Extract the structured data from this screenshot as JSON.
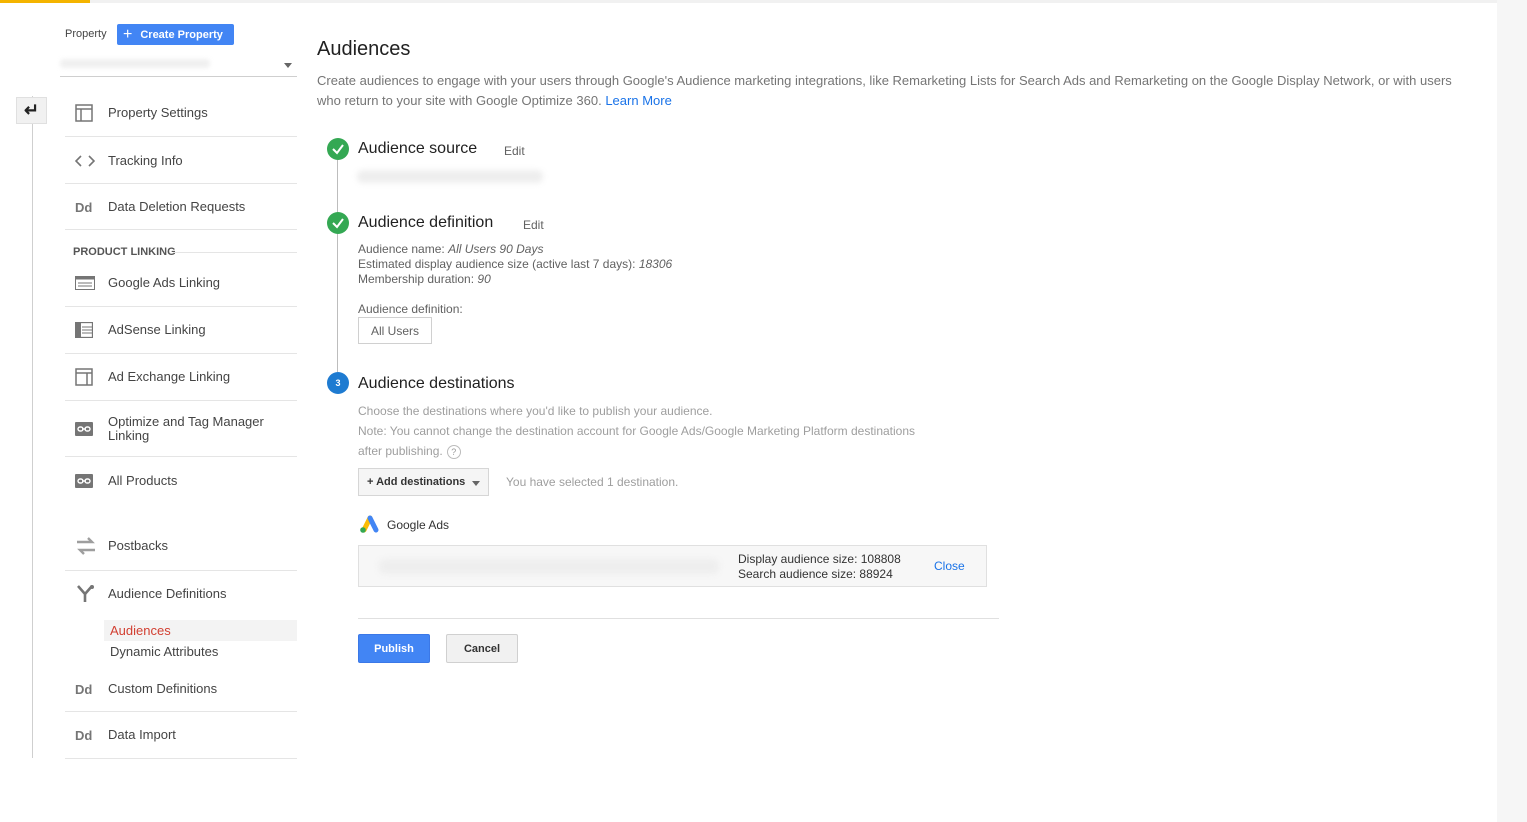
{
  "sidebar": {
    "property_label": "Property",
    "create_property_label": "Create Property",
    "items": [
      {
        "label": "Property Settings",
        "icon": "page-layout-icon"
      },
      {
        "label": "Tracking Info",
        "icon": "code-brackets-icon"
      },
      {
        "label": "Data Deletion Requests",
        "icon": "Dd"
      },
      {
        "label": "Google Ads Linking",
        "icon": "list-icon"
      },
      {
        "label": "AdSense Linking",
        "icon": "list-table-icon"
      },
      {
        "label": "Ad Exchange Linking",
        "icon": "page-layout-icon"
      },
      {
        "label": "Optimize and Tag Manager Linking",
        "icon": "link-icon"
      },
      {
        "label": "All Products",
        "icon": "link-icon"
      },
      {
        "label": "Postbacks",
        "icon": "arrows-swap-icon"
      },
      {
        "label": "Audience Definitions",
        "icon": "fork-icon"
      },
      {
        "label": "Custom Definitions",
        "icon": "Dd"
      },
      {
        "label": "Data Import",
        "icon": "Dd"
      }
    ],
    "section_product_linking": "PRODUCT LINKING",
    "sub_items": [
      {
        "label": "Audiences",
        "active": true
      },
      {
        "label": "Dynamic Attributes",
        "active": false
      }
    ],
    "dd_glyph": "Dd"
  },
  "main": {
    "title": "Audiences",
    "description": "Create audiences to engage with your users through Google's Audience marketing integrations, like Remarketing Lists for Search Ads and Remarketing on the Google Display Network, or with users who return to your site with Google Optimize 360.",
    "learn_more": "Learn More",
    "step1": {
      "title": "Audience source",
      "edit": "Edit"
    },
    "step2": {
      "title": "Audience definition",
      "edit": "Edit",
      "name_label": "Audience name:",
      "name_value": "All Users 90 Days",
      "size_label": "Estimated display audience size (active last 7 days):",
      "size_value": "18306",
      "duration_label": "Membership duration:",
      "duration_value": "90",
      "definition_label": "Audience definition:",
      "definition_chip": "All Users"
    },
    "step3": {
      "number": "3",
      "title": "Audience destinations",
      "line1": "Choose the destinations where you'd like to publish your audience.",
      "line2": "Note: You cannot change the destination account for Google Ads/Google Marketing Platform destinations",
      "line3": "after publishing.",
      "help": "?",
      "add_destinations": "+ Add destinations",
      "selected_text": "You have selected 1 destination.",
      "destination_name": "Google Ads",
      "display_size": "Display audience size: 108808",
      "search_size": "Search audience size: 88924",
      "close": "Close"
    },
    "publish": "Publish",
    "cancel": "Cancel"
  },
  "colors": {
    "primary": "#4285f4",
    "success": "#34a853",
    "step_active": "#1e7bd1",
    "active_nav": "#d23f31",
    "link": "#1a73e8",
    "accent_top": "#f4b400"
  }
}
